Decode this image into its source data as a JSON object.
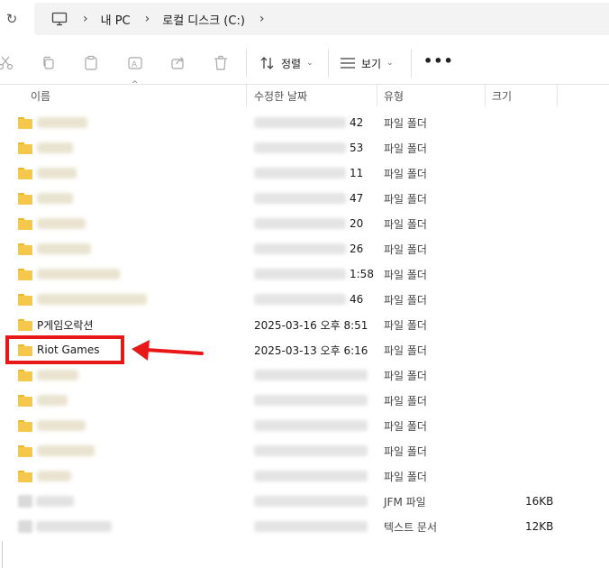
{
  "address": {
    "crumbs": [
      "내 PC",
      "로컬 디스크 (C:)"
    ]
  },
  "toolbar": {
    "sort_label": "정렬",
    "view_label": "보기",
    "more_label": "•••"
  },
  "columns": {
    "name": "이름",
    "date": "수정한 날짜",
    "type": "유형",
    "size": "크기"
  },
  "rows": [
    {
      "name": "",
      "date_suffix": "42",
      "type": "파일 폴더",
      "size": ""
    },
    {
      "name": "",
      "date_suffix": "53",
      "type": "파일 폴더",
      "size": ""
    },
    {
      "name": "",
      "date_suffix": "11",
      "type": "파일 폴더",
      "size": ""
    },
    {
      "name": "",
      "date_suffix": "47",
      "type": "파일 폴더",
      "size": ""
    },
    {
      "name": "",
      "date_suffix": "20",
      "type": "파일 폴더",
      "size": ""
    },
    {
      "name": "",
      "date_suffix": "26",
      "type": "파일 폴더",
      "size": ""
    },
    {
      "name": "",
      "date_suffix": "1:58",
      "type": "파일 폴더",
      "size": ""
    },
    {
      "name": "",
      "date_suffix": "46",
      "type": "파일 폴더",
      "size": ""
    },
    {
      "name": "P게임오락션",
      "date": "2025-03-16 오후 8:51",
      "type": "파일 폴더",
      "size": ""
    },
    {
      "name": "Riot Games",
      "date": "2025-03-13 오후 6:16",
      "type": "파일 폴더",
      "size": ""
    },
    {
      "name": "",
      "date_suffix": "",
      "type": "파일 폴더",
      "size": ""
    },
    {
      "name": "",
      "date_suffix": "",
      "type": "파일 폴더",
      "size": ""
    },
    {
      "name": "",
      "date_suffix": "",
      "type": "파일 폴더",
      "size": ""
    },
    {
      "name": "",
      "date_suffix": "",
      "type": "파일 폴더",
      "size": ""
    },
    {
      "name": "",
      "date_suffix": "",
      "type": "파일 폴더",
      "size": ""
    },
    {
      "name": "",
      "date_suffix": "",
      "type": "JFM 파일",
      "size": "16KB"
    },
    {
      "name": "",
      "date_suffix": "",
      "type": "텍스트 문서",
      "size": "12KB"
    }
  ],
  "colors": {
    "highlight": "#e81818",
    "folder": "#f5c84c"
  }
}
